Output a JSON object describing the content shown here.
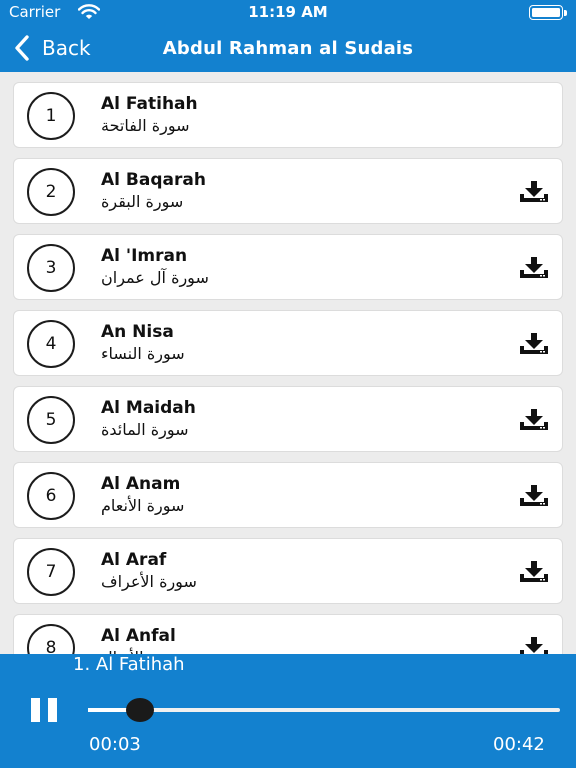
{
  "status_bar": {
    "carrier": "Carrier",
    "time": "11:19 AM",
    "battery_level": 1.0
  },
  "nav": {
    "back_label": "Back",
    "title": "Abdul Rahman al Sudais"
  },
  "surahs": [
    {
      "number": "1",
      "name_en": "Al Fatihah",
      "name_ar": "سورة الفاتحة",
      "downloadable": false
    },
    {
      "number": "2",
      "name_en": "Al Baqarah",
      "name_ar": "سورة البقرة",
      "downloadable": true
    },
    {
      "number": "3",
      "name_en": "Al 'Imran",
      "name_ar": "سورة آل عمران",
      "downloadable": true
    },
    {
      "number": "4",
      "name_en": "An Nisa",
      "name_ar": "سورة النساء",
      "downloadable": true
    },
    {
      "number": "5",
      "name_en": "Al Maidah",
      "name_ar": "سورة المائدة",
      "downloadable": true
    },
    {
      "number": "6",
      "name_en": "Al Anam",
      "name_ar": "سورة الأنعام",
      "downloadable": true
    },
    {
      "number": "7",
      "name_en": "Al Araf",
      "name_ar": "سورة الأعراف",
      "downloadable": true
    },
    {
      "number": "8",
      "name_en": "Al Anfal",
      "name_ar": "سورة الأنفال",
      "downloadable": true
    }
  ],
  "player": {
    "now_playing": "1. Al Fatihah",
    "elapsed": "00:03",
    "total": "00:42",
    "progress": 0.11
  },
  "icons": {
    "back": "chevron-left-icon",
    "download": "download-icon",
    "pause": "pause-icon",
    "wifi": "wifi-icon",
    "battery": "battery-icon"
  },
  "colors": {
    "accent": "#1381cf",
    "background": "#ececec",
    "card": "#ffffff",
    "text": "#111111"
  }
}
